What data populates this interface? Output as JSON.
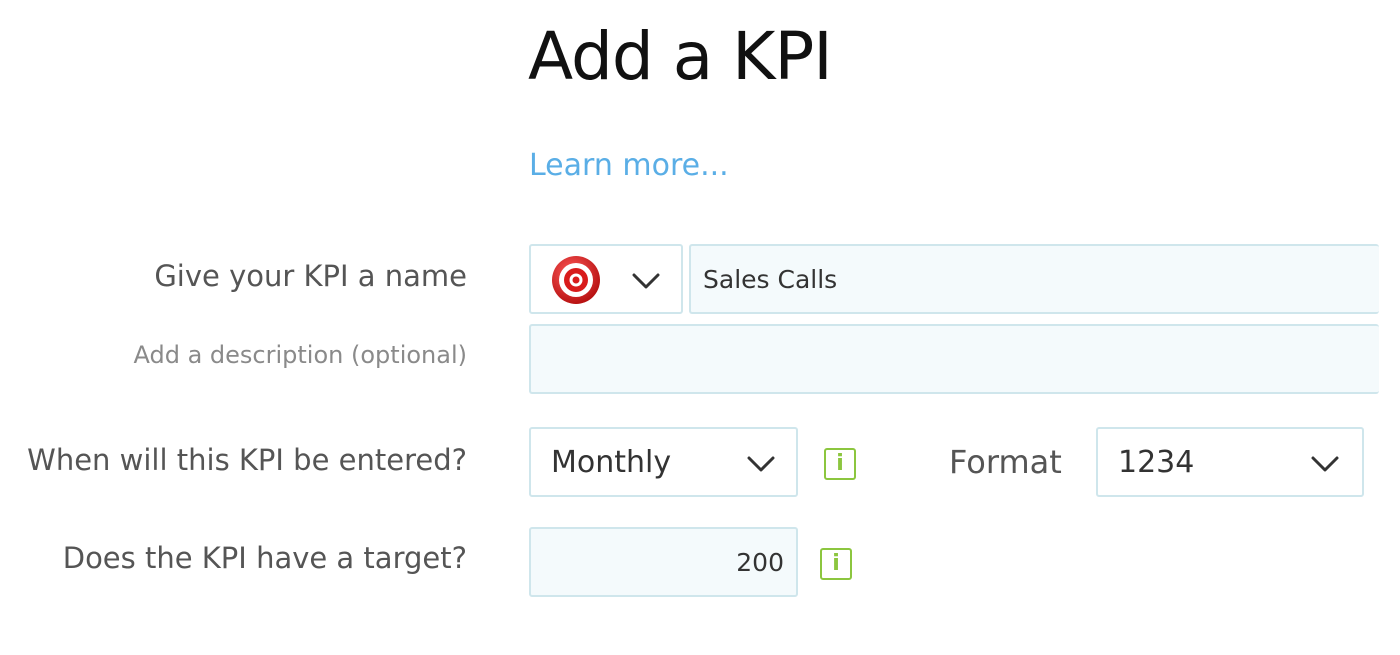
{
  "page": {
    "title": "Add a KPI",
    "learn_more": "Learn more..."
  },
  "form": {
    "name_label": "Give your KPI a name",
    "icon": "target-icon",
    "name_value": "Sales Calls",
    "description_label": "Add a description (optional)",
    "description_value": "",
    "frequency_label": "When will this KPI be entered?",
    "frequency_value": "Monthly",
    "format_label": "Format",
    "format_value": "1234",
    "target_label": "Does the KPI have a target?",
    "target_value": "200",
    "info_glyph": "i"
  },
  "colors": {
    "link": "#5aaee6",
    "info_icon": "#8cc63f",
    "input_border": "#cfe6ec",
    "input_bg": "#f4fafc"
  }
}
